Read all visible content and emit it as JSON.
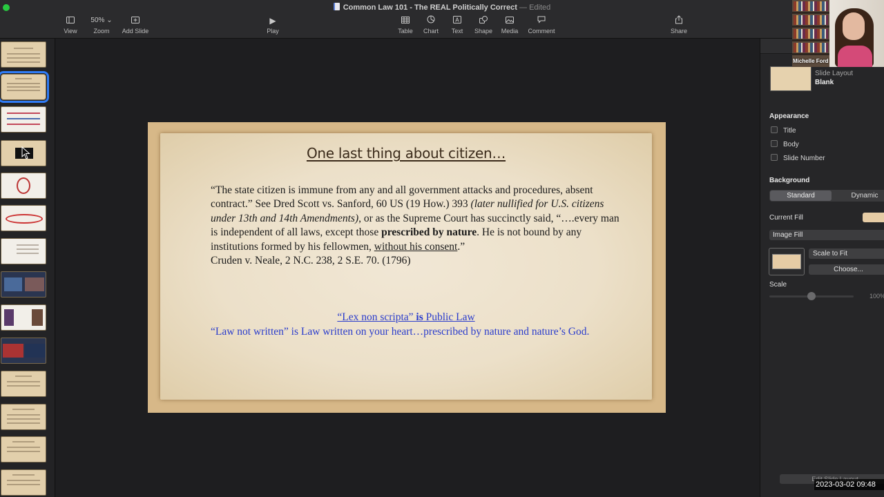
{
  "window": {
    "title": "Common Law 101 - The REAL Politically Correct",
    "title_separator": " — ",
    "status": "Edited",
    "accent_color": "#2f7bf5"
  },
  "toolbar": {
    "view_label": "View",
    "zoom_value": "50%",
    "zoom_label": "Zoom",
    "add_slide_label": "Add Slide",
    "play_label": "Play",
    "table_label": "Table",
    "chart_label": "Chart",
    "text_label": "Text",
    "shape_label": "Shape",
    "media_label": "Media",
    "comment_label": "Comment",
    "share_label": "Share"
  },
  "navigator": {
    "slide_count": 14,
    "selected_index": 2
  },
  "slide": {
    "title": "One last thing about citizen…",
    "p1_a": "“The state citizen is immune from any and all government attacks and procedures, absent contract.” See Dred Scott vs. Sanford, 60 US (19 How.) 393 ",
    "p1_italic": "(later nullified for U.S. citizens under 13th and 14th Amendments)",
    "p1_b": ", or as the Supreme Court has succinctly said, “….every man is independent of all laws, except those ",
    "p1_bold": "prescribed by nature",
    "p1_c": ". He is not bound by any institutions formed by his fellowmen, ",
    "p1_underline": "without his consent",
    "p1_d": ".”",
    "citation": "Cruden v. Neale, 2 N.C. 238, 2 S.E. 70. (1796)",
    "lex_a": "“Lex non scripta” ",
    "lex_bold": "is",
    "lex_b": " Public Law",
    "law_text": "“Law not written” is Law written on your heart…prescribed by nature and nature’s God.",
    "link_color": "#2a3ccc"
  },
  "inspector": {
    "slide_layout_label": "Slide Layout",
    "slide_layout_value": "Blank",
    "appearance_heading": "Appearance",
    "check_title": "Title",
    "check_body": "Body",
    "check_slide_number": "Slide Number",
    "background_heading": "Background",
    "seg_standard": "Standard",
    "seg_dynamic": "Dynamic",
    "current_fill_label": "Current Fill",
    "fill_type": "Image Fill",
    "scale_mode": "Scale to Fit",
    "choose_button": "Choose...",
    "scale_label": "Scale",
    "scale_value": "100%",
    "scale_fraction": 0.5,
    "edit_layout_button": "Edit Slide Layout"
  },
  "webcam": {
    "participant_name": "Michelle Ford"
  },
  "overlay": {
    "timestamp": "2023-03-02 09:48"
  }
}
